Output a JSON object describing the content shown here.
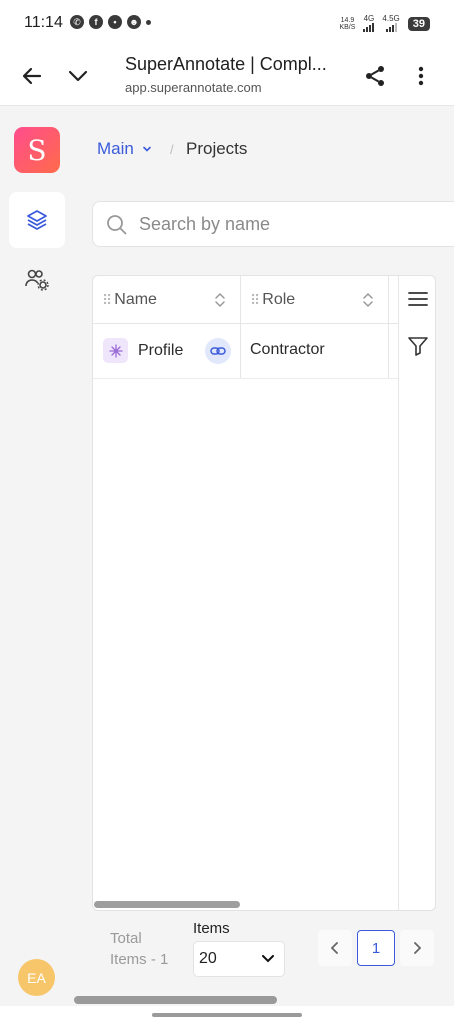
{
  "status_bar": {
    "time": "11:14",
    "net_speed_value": "14.9",
    "net_speed_unit": "KB/S",
    "net1": "4G",
    "net2": "4.5G",
    "battery": "39"
  },
  "browser": {
    "title": "SuperAnnotate | Compl...",
    "url": "app.superannotate.com"
  },
  "sidebar": {
    "logo_letter": "S",
    "items": [
      {
        "icon": "layers-icon",
        "active": true
      },
      {
        "icon": "team-settings-icon",
        "active": false
      }
    ],
    "avatar_initials": "EA"
  },
  "breadcrumb": {
    "main": "Main",
    "separator": "/",
    "current": "Projects"
  },
  "search": {
    "placeholder": "Search by name",
    "value": ""
  },
  "table": {
    "columns": [
      {
        "label": "Name"
      },
      {
        "label": "Role"
      }
    ],
    "rows": [
      {
        "name": "Profile",
        "role": "Contractor"
      }
    ]
  },
  "footer": {
    "total_line1": "Total",
    "total_line2": "Items - 1",
    "items_label": "Items",
    "items_per_page": "20",
    "current_page": "1"
  },
  "colors": {
    "accent": "#3b5bdb",
    "logo_start": "#ff4d8d",
    "logo_end": "#ff6b4a",
    "avatar": "#f7c66b"
  }
}
